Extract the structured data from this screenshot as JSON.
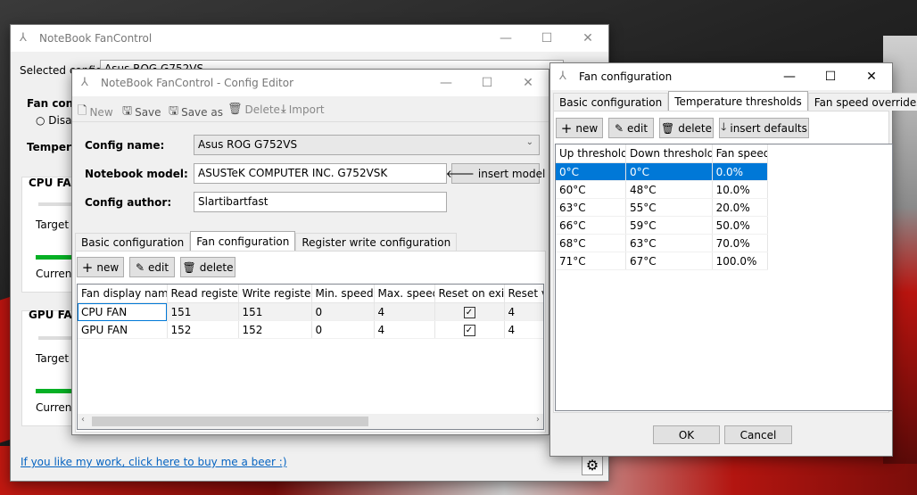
{
  "main_window": {
    "title": "NoteBook FanControl",
    "selected_config_label": "Selected config",
    "selected_config_value": "Asus ROG G752VS",
    "fan_control_label": "Fan contr",
    "disable_label": "Disa",
    "temperature_label": "Tempera",
    "cpu_fan_label": "CPU FAN",
    "gpu_fan_label": "GPU FAN",
    "target_label": "Target f",
    "current_label": "Current",
    "beer_link": "If you like my work, click here to buy me a beer :)"
  },
  "config_editor": {
    "title": "NoteBook FanControl - Config Editor",
    "toolbar": {
      "new": "New",
      "save": "Save",
      "save_as": "Save as",
      "delete": "Delete",
      "import": "Import"
    },
    "config_name_label": "Config name:",
    "config_name_value": "Asus ROG G752VS",
    "notebook_model_label": "Notebook model:",
    "notebook_model_value": "ASUSTeK COMPUTER INC. G752VSK",
    "insert_model": "insert model",
    "config_author_label": "Config author:",
    "config_author_value": "Slartibartfast",
    "tabs": [
      "Basic configuration",
      "Fan configuration",
      "Register write configuration"
    ],
    "buttons": {
      "new": "new",
      "edit": "edit",
      "delete": "delete"
    },
    "columns": [
      "Fan display name",
      "Read register",
      "Write register",
      "Min. speed",
      "Max. speed",
      "Reset on exit",
      "Reset va"
    ],
    "rows": [
      {
        "name": "CPU FAN",
        "read": "151",
        "write": "151",
        "min": "0",
        "max": "4",
        "reset_value": "4"
      },
      {
        "name": "GPU FAN",
        "read": "152",
        "write": "152",
        "min": "0",
        "max": "4",
        "reset_value": "4"
      }
    ]
  },
  "fan_config": {
    "title": "Fan configuration",
    "tabs": [
      "Basic configuration",
      "Temperature thresholds",
      "Fan speed overrides"
    ],
    "buttons": {
      "new": "new",
      "edit": "edit",
      "delete": "delete",
      "insert_defaults": "insert defaults"
    },
    "columns": [
      "Up threshold",
      "Down threshold",
      "Fan speed"
    ],
    "rows": [
      {
        "up": "0°C",
        "down": "0°C",
        "speed": "0.0%"
      },
      {
        "up": "60°C",
        "down": "48°C",
        "speed": "10.0%"
      },
      {
        "up": "63°C",
        "down": "55°C",
        "speed": "20.0%"
      },
      {
        "up": "66°C",
        "down": "59°C",
        "speed": "50.0%"
      },
      {
        "up": "68°C",
        "down": "63°C",
        "speed": "70.0%"
      },
      {
        "up": "71°C",
        "down": "67°C",
        "speed": "100.0%"
      }
    ],
    "ok": "OK",
    "cancel": "Cancel"
  },
  "colors": {
    "accent": "#0078d7",
    "progress": "#06b025",
    "link": "#0563c1"
  }
}
